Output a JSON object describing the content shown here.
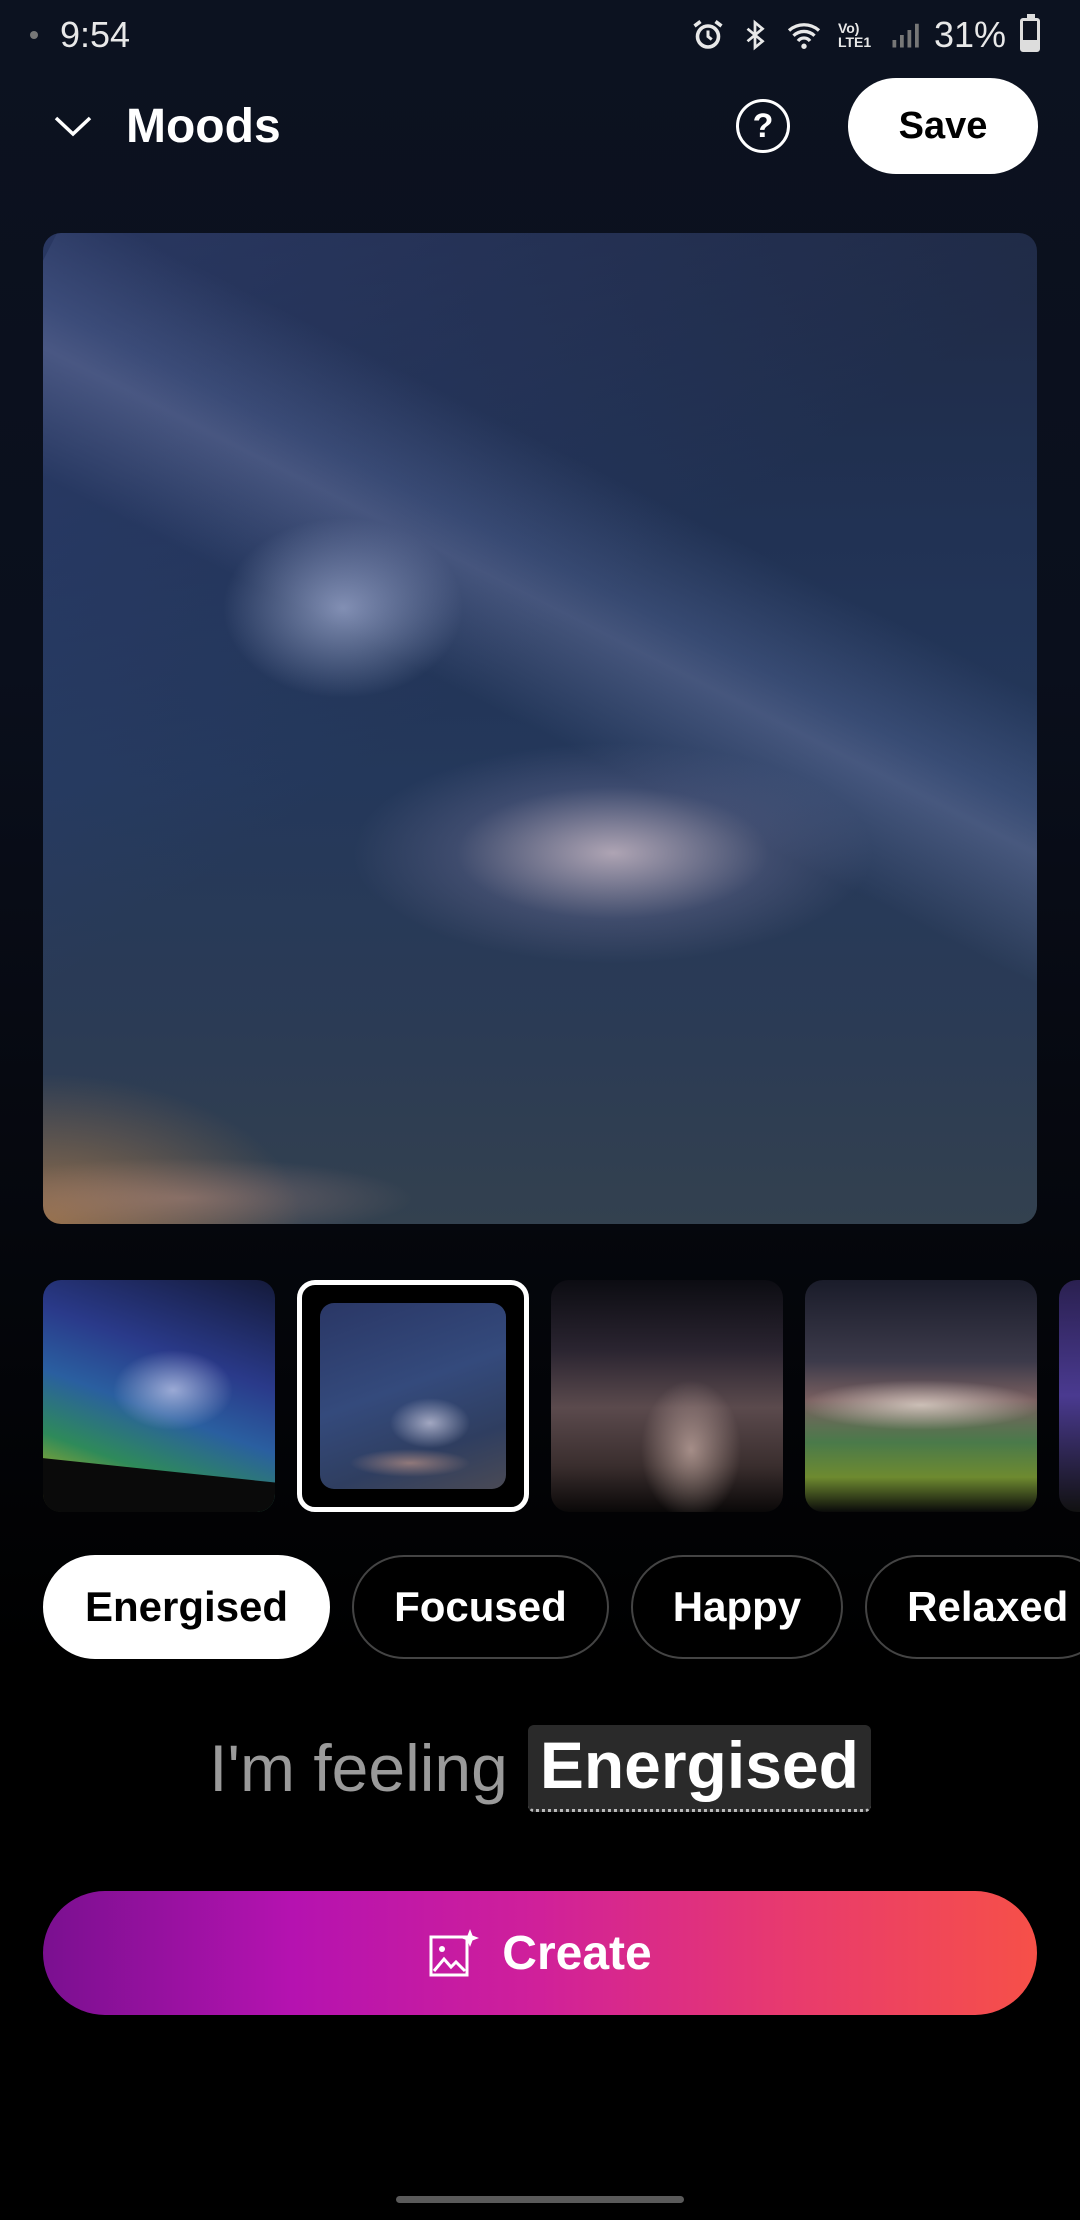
{
  "status_bar": {
    "time": "9:54",
    "network_label": "Vo) LTE1",
    "battery": "31%",
    "battery_level": 0.31
  },
  "header": {
    "title": "Moods",
    "help_label": "?",
    "save_label": "Save"
  },
  "thumbnails": {
    "count": 5,
    "selected_index": 1
  },
  "moods": {
    "items": [
      {
        "label": "Energised",
        "active": true
      },
      {
        "label": "Focused",
        "active": false
      },
      {
        "label": "Happy",
        "active": false
      },
      {
        "label": "Relaxed",
        "active": false
      }
    ]
  },
  "feeling": {
    "prefix": "I'm feeling",
    "value": "Energised"
  },
  "create": {
    "label": "Create",
    "gradient_start": "#7a1090",
    "gradient_end": "#f65048"
  },
  "icons": {
    "collapse": "chevron-down-icon",
    "help": "help-circle-icon",
    "create": "image-sparkle-icon"
  }
}
